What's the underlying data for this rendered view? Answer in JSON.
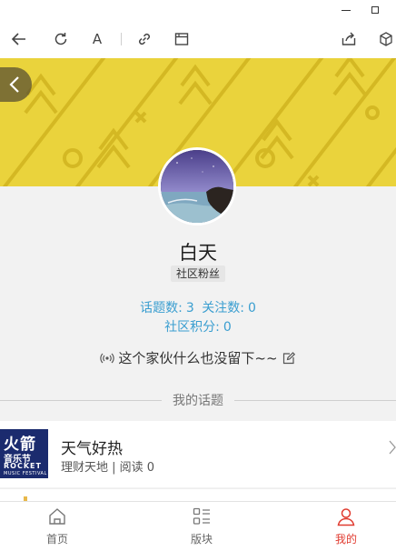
{
  "toolbar": {
    "back_icon": "arrow-left-icon",
    "refresh_icon": "refresh-icon",
    "font_label": "A",
    "link_icon": "link-icon",
    "window_icon": "window-icon",
    "share_icon": "share-icon",
    "cube_icon": "cube-icon"
  },
  "profile": {
    "name": "白天",
    "badge": "社区粉丝",
    "topics_count_label": "话题数:",
    "topics_count": "3",
    "follow_count_label": "关注数:",
    "follow_count": "0",
    "points_label": "社区积分:",
    "points": "0",
    "bio": "这个家伙什么也没留下~~"
  },
  "section": {
    "title": "我的话题"
  },
  "topics": [
    {
      "thumb_line1": "火箭",
      "thumb_line2": "音乐节",
      "thumb_line3": "ROCKET",
      "thumb_line4": "MUSIC FESTIVAL",
      "title": "天气好热",
      "meta": "理财天地 | 阅读 0"
    }
  ],
  "bottom_nav": [
    {
      "label": "首页",
      "icon": "home-icon",
      "active": false
    },
    {
      "label": "版块",
      "icon": "list-icon",
      "active": false
    },
    {
      "label": "我的",
      "icon": "user-icon",
      "active": true
    }
  ],
  "colors": {
    "banner": "#ead33c",
    "stats": "#3a9ed0",
    "active_nav": "#e03b30"
  }
}
